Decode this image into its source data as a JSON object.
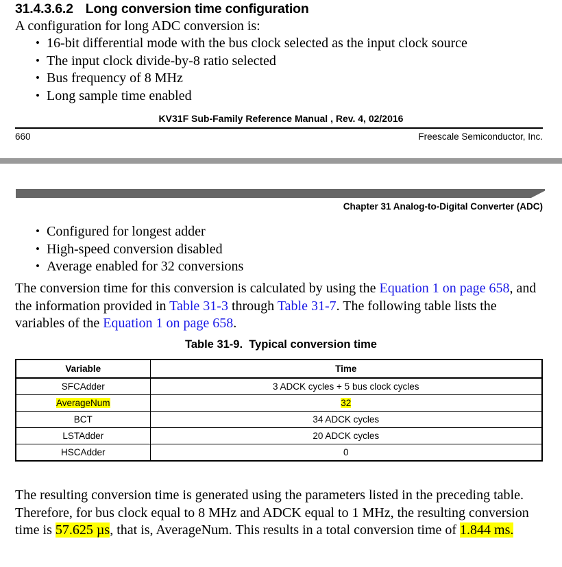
{
  "heading": {
    "number": "31.4.3.6.2",
    "title": "Long conversion time configuration"
  },
  "intro": {
    "lead_in": "A configuration for long ADC conversion is:",
    "bullets": [
      "16-bit differential mode with the bus clock selected as the input clock source",
      "The input clock divide-by-8 ratio selected",
      "Bus frequency of 8 MHz",
      "Long sample time enabled"
    ]
  },
  "footer": {
    "manual_title": "KV31F Sub-Family Reference Manual , Rev. 4, 02/2016",
    "page_number": "660",
    "company": "Freescale Semiconductor, Inc."
  },
  "chapter_header": {
    "title": "Chapter 31 Analog-to-Digital Converter (ADC)"
  },
  "continued": {
    "bullets": [
      "Configured for longest adder",
      "High-speed conversion disabled",
      "Average enabled for 32 conversions"
    ]
  },
  "conversion_paragraph": {
    "part1": "The conversion time for this conversion is calculated by using the ",
    "link1": "Equation 1 on page 658",
    "part2": ", and the information provided in ",
    "link2": "Table 31-3",
    "part3": " through ",
    "link3": "Table 31-7",
    "part4": ". The following table lists the variables of the ",
    "link4": "Equation 1 on page 658",
    "part5": "."
  },
  "table": {
    "caption_label": "Table 31-9.",
    "caption_title": "Typical conversion time",
    "columns": [
      "Variable",
      "Time"
    ],
    "rows": [
      {
        "variable": "SFCAdder",
        "time": "3 ADCK cycles + 5 bus clock cycles",
        "variable_highlight": false,
        "time_highlight": false
      },
      {
        "variable": "AverageNum",
        "time": "32",
        "variable_highlight": true,
        "time_highlight": true
      },
      {
        "variable": "BCT",
        "time": "34 ADCK cycles",
        "variable_highlight": false,
        "time_highlight": false
      },
      {
        "variable": "LSTAdder",
        "time": "20 ADCK cycles",
        "variable_highlight": false,
        "time_highlight": false
      },
      {
        "variable": "HSCAdder",
        "time": "0",
        "variable_highlight": false,
        "time_highlight": false
      }
    ]
  },
  "result_paragraph": {
    "part1": "The resulting conversion time is generated using the parameters listed in the preceding table. Therefore, for bus clock equal to 8 MHz and ADCK equal to 1 MHz, the resulting conversion time is ",
    "highlight1": "57.625 µs",
    "part2": ", that is, AverageNum. This results in a total conversion time of ",
    "highlight2": "1.844 ms.",
    "part3": ""
  },
  "colors": {
    "link": "#1a1ae6",
    "highlight": "#ffff00",
    "banner_dark": "#666666",
    "page_break_band": "#9a9a9a"
  }
}
